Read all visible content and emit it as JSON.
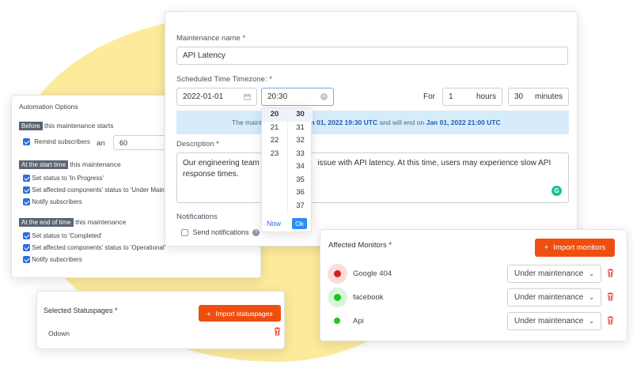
{
  "maintenance": {
    "name_label": "Maintenance name *",
    "name_value": "API Latency",
    "time_label": "Scheduled Time Timezone: *",
    "date_value": "2022-01-01",
    "time_value": "20:30",
    "for_label": "For",
    "hours_value": "1",
    "hours_unit": "hours",
    "minutes_value": "30",
    "minutes_unit": "minutes",
    "info_prefix": "The mainte",
    "info_date1": "n Jan 01, 2022 19:30 UTC",
    "info_mid": "and will end on",
    "info_date2": "Jan 01, 2022 21:00 UTC",
    "description_label": "Description *",
    "description_a": "Our engineering team is",
    "description_b": "issue with API latency. At this time, users may experience slow API",
    "description_c": "response times.",
    "notifications_label": "Notifications",
    "send_notifications": "Send notifications"
  },
  "timepicker": {
    "hours": [
      "20",
      "21",
      "22",
      "23"
    ],
    "minutes": [
      "30",
      "31",
      "32",
      "33",
      "34",
      "35",
      "36",
      "37"
    ],
    "now_label": "Now",
    "ok_label": "Ok"
  },
  "automation": {
    "title": "Automation Options",
    "before_tag": "Before",
    "before_text": "this maintenance starts",
    "remind_label": "Remind subscribers",
    "an_label": "an",
    "remind_value": "60",
    "start_tag": "At the start time",
    "start_text": "this maintenance",
    "start_items": [
      "Set status to 'In Progress'",
      "Set affected components' status to 'Under Mainten",
      "Notify subscribers"
    ],
    "end_tag": "At the end of time",
    "end_text": "this maintenance",
    "end_items": [
      "Set status to 'Completed'",
      "Set affected components' status to 'Operational'",
      "Notify subscribers"
    ]
  },
  "statuspages": {
    "title": "Selected Statuspages *",
    "import_label": "Import statuspages",
    "item": "Odown"
  },
  "monitors": {
    "title": "Affected Monitors *",
    "import_label": "Import monitors",
    "items": [
      {
        "name": "Google 404",
        "status": "Under maintenance",
        "color": "#e01b1b"
      },
      {
        "name": "facebook",
        "status": "Under maintenance",
        "color": "#22c51f"
      },
      {
        "name": "Api",
        "status": "Under maintenance",
        "color": "#22c51f"
      }
    ]
  },
  "colors": {
    "accent_orange": "#f04e0f",
    "info_bg": "#d7ecfb",
    "link_blue": "#1d5fae",
    "blob": "#fde68a"
  }
}
